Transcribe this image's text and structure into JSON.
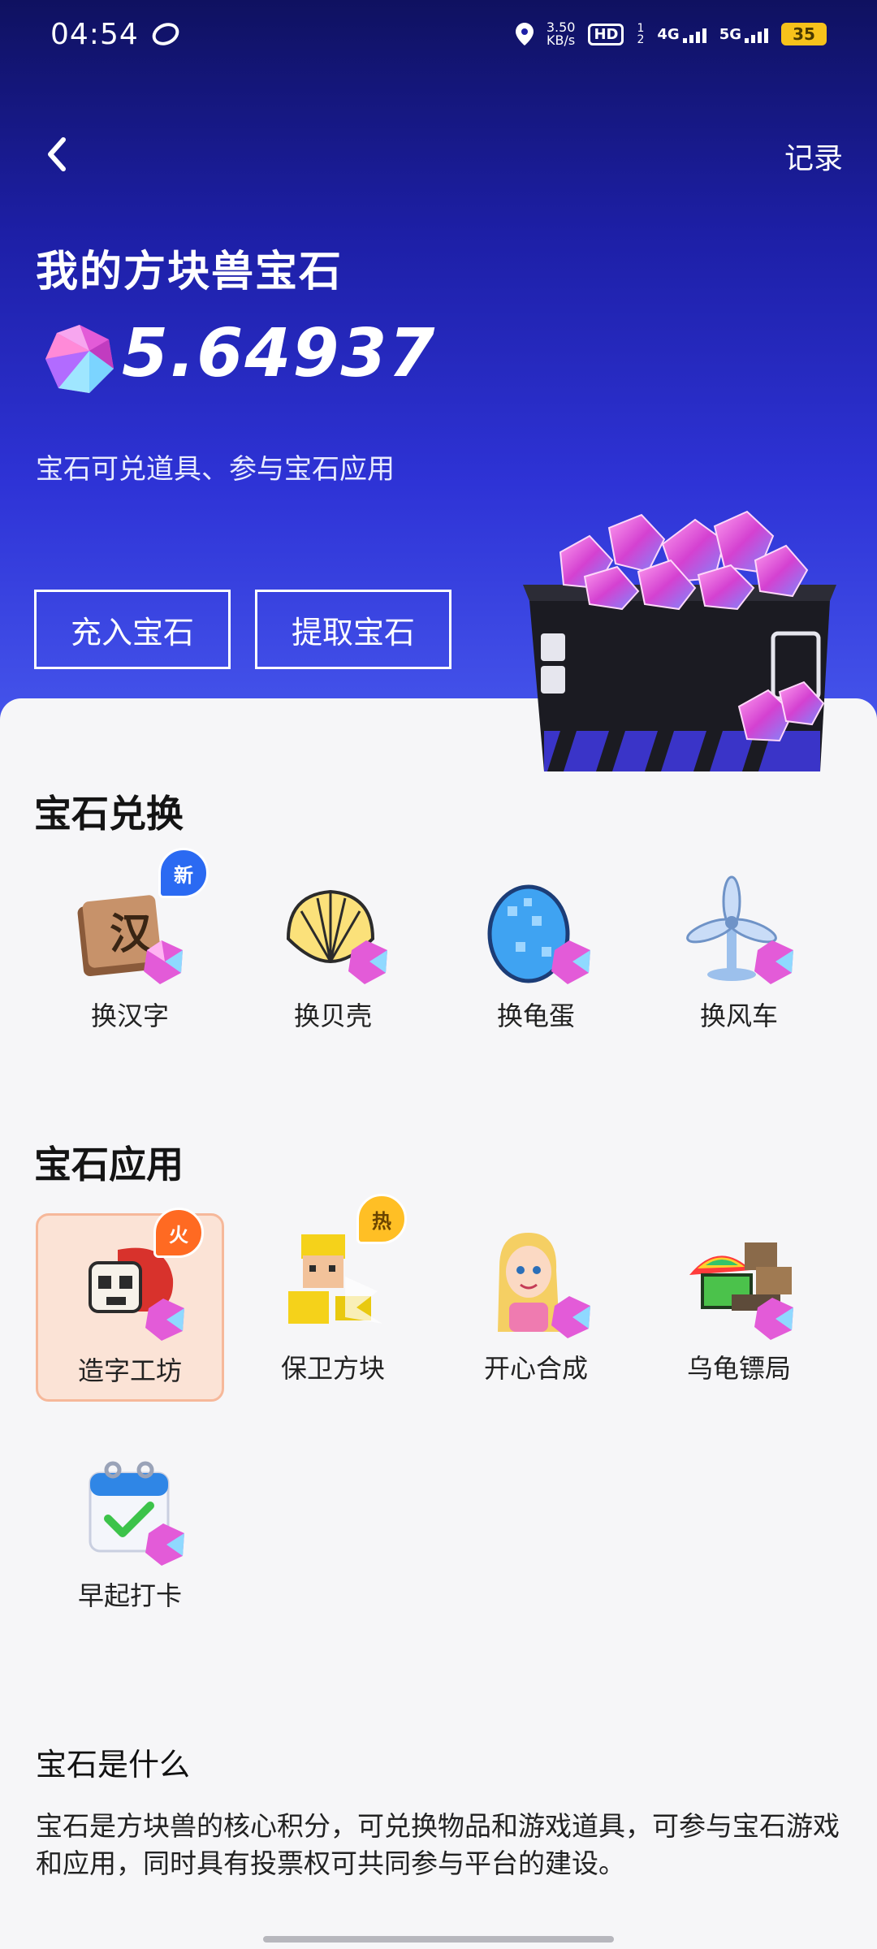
{
  "status_bar": {
    "time": "04:54",
    "net_speed": "3.50",
    "net_unit": "KB/s",
    "hd": "HD",
    "sim1": "1",
    "sim2": "2",
    "net1": "4G",
    "net2": "5G",
    "battery": "35"
  },
  "header": {
    "record_label": "记录",
    "title": "我的方块兽宝石",
    "balance": "5.64937",
    "subtitle": "宝石可兑道具、参与宝石应用",
    "charge_label": "充入宝石",
    "withdraw_label": "提取宝石"
  },
  "exchange": {
    "title": "宝石兑换",
    "items": [
      {
        "label": "换汉字",
        "badge": "新"
      },
      {
        "label": "换贝壳"
      },
      {
        "label": "换龟蛋"
      },
      {
        "label": "换风车"
      }
    ]
  },
  "apps": {
    "title": "宝石应用",
    "items": [
      {
        "label": "造字工坊",
        "badge": "火"
      },
      {
        "label": "保卫方块",
        "badge": "热"
      },
      {
        "label": "开心合成"
      },
      {
        "label": "乌龟镖局"
      },
      {
        "label": "早起打卡"
      }
    ]
  },
  "about": {
    "title": "宝石是什么",
    "description": "宝石是方块兽的核心积分，可兑换物品和游戏道具，可参与宝石游戏和应用，同时具有投票权可共同参与平台的建设。"
  },
  "colors": {
    "hero_top": "#0f1160",
    "hero_bottom": "#4a5cf0",
    "gem": "#e35bd8",
    "badge_new": "#2b6af2",
    "badge_fire": "#ff6a22",
    "badge_hot": "#ffbf25"
  },
  "icons": [
    "location-icon",
    "gem-icon",
    "back-arrow-icon",
    "treasure-box-art"
  ]
}
